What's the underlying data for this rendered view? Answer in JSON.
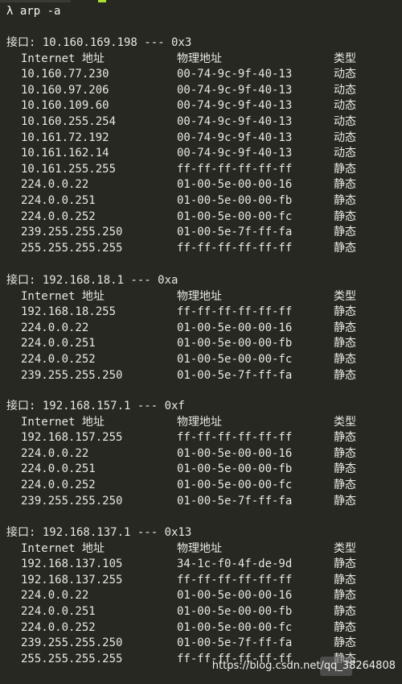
{
  "command": "λ arp -a",
  "labels": {
    "col_ip": "Internet 地址",
    "col_mac": "物理地址",
    "col_type": "类型"
  },
  "interfaces": [
    {
      "header": "接口: 10.160.169.198 --- 0x3",
      "rows": [
        [
          "10.160.77.230",
          "00-74-9c-9f-40-13",
          "动态"
        ],
        [
          "10.160.97.206",
          "00-74-9c-9f-40-13",
          "动态"
        ],
        [
          "10.160.109.60",
          "00-74-9c-9f-40-13",
          "动态"
        ],
        [
          "10.160.255.254",
          "00-74-9c-9f-40-13",
          "动态"
        ],
        [
          "10.161.72.192",
          "00-74-9c-9f-40-13",
          "动态"
        ],
        [
          "10.161.162.14",
          "00-74-9c-9f-40-13",
          "动态"
        ],
        [
          "10.161.255.255",
          "ff-ff-ff-ff-ff-ff",
          "静态"
        ],
        [
          "224.0.0.22",
          "01-00-5e-00-00-16",
          "静态"
        ],
        [
          "224.0.0.251",
          "01-00-5e-00-00-fb",
          "静态"
        ],
        [
          "224.0.0.252",
          "01-00-5e-00-00-fc",
          "静态"
        ],
        [
          "239.255.255.250",
          "01-00-5e-7f-ff-fa",
          "静态"
        ],
        [
          "255.255.255.255",
          "ff-ff-ff-ff-ff-ff",
          "静态"
        ]
      ]
    },
    {
      "header": "接口: 192.168.18.1 --- 0xa",
      "rows": [
        [
          "192.168.18.255",
          "ff-ff-ff-ff-ff-ff",
          "静态"
        ],
        [
          "224.0.0.22",
          "01-00-5e-00-00-16",
          "静态"
        ],
        [
          "224.0.0.251",
          "01-00-5e-00-00-fb",
          "静态"
        ],
        [
          "224.0.0.252",
          "01-00-5e-00-00-fc",
          "静态"
        ],
        [
          "239.255.255.250",
          "01-00-5e-7f-ff-fa",
          "静态"
        ]
      ]
    },
    {
      "header": "接口: 192.168.157.1 --- 0xf",
      "rows": [
        [
          "192.168.157.255",
          "ff-ff-ff-ff-ff-ff",
          "静态"
        ],
        [
          "224.0.0.22",
          "01-00-5e-00-00-16",
          "静态"
        ],
        [
          "224.0.0.251",
          "01-00-5e-00-00-fb",
          "静态"
        ],
        [
          "224.0.0.252",
          "01-00-5e-00-00-fc",
          "静态"
        ],
        [
          "239.255.255.250",
          "01-00-5e-7f-ff-fa",
          "静态"
        ]
      ]
    },
    {
      "header": "接口: 192.168.137.1 --- 0x13",
      "rows": [
        [
          "192.168.137.105",
          "34-1c-f0-4f-de-9d",
          "静态"
        ],
        [
          "192.168.137.255",
          "ff-ff-ff-ff-ff-ff",
          "静态"
        ],
        [
          "224.0.0.22",
          "01-00-5e-00-00-16",
          "静态"
        ],
        [
          "224.0.0.251",
          "01-00-5e-00-00-fb",
          "静态"
        ],
        [
          "224.0.0.252",
          "01-00-5e-00-00-fc",
          "静态"
        ],
        [
          "239.255.255.250",
          "01-00-5e-7f-ff-fa",
          "静态"
        ],
        [
          "255.255.255.255",
          "ff-ff-ff-ff-ff-ff",
          "静态"
        ]
      ]
    }
  ],
  "watermark": "https://blog.csdn.net/qq_38264808"
}
